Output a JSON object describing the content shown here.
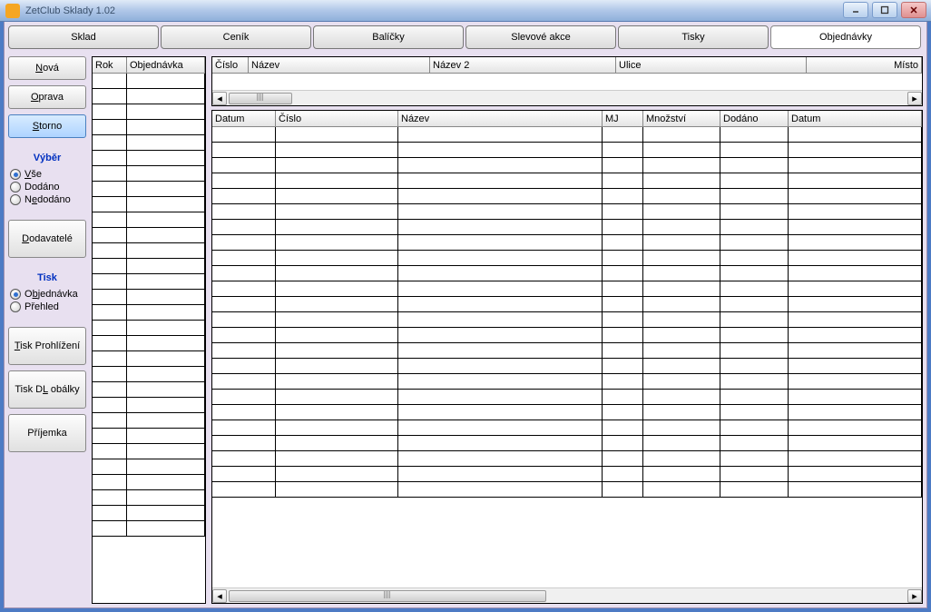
{
  "window": {
    "title": "ZetClub Sklady 1.02"
  },
  "tabs": [
    "Sklad",
    "Ceník",
    "Balíčky",
    "Slevové akce",
    "Tisky",
    "Objednávky"
  ],
  "tabs_selected_index": 5,
  "sidebar": {
    "btn_new": "Nová",
    "btn_edit": "Oprava",
    "btn_storno": "Storno",
    "hdr_filter": "Výběr",
    "radio_all": "Vše",
    "radio_delivered": "Dodáno",
    "radio_notdelivered": "Nedodáno",
    "filter_selected": "Vše",
    "btn_suppliers": "Dodavatelé",
    "hdr_print": "Tisk",
    "radio_order": "Objednávka",
    "radio_summary": "Přehled",
    "print_selected": "Objednávka",
    "btn_printview": "Tisk Prohlížení",
    "btn_printdl": "Tisk DL obálky",
    "btn_receipt": "Příjemka"
  },
  "ordersGrid": {
    "columns": [
      "Rok",
      "Objednávka"
    ]
  },
  "supplierGrid": {
    "columns": [
      "Číslo",
      "Název",
      "Název 2",
      "Ulice",
      "Místo"
    ]
  },
  "itemsGrid": {
    "columns": [
      "Datum",
      "Číslo",
      "Název",
      "MJ",
      "Množství",
      "Dodáno",
      "Datum"
    ]
  }
}
